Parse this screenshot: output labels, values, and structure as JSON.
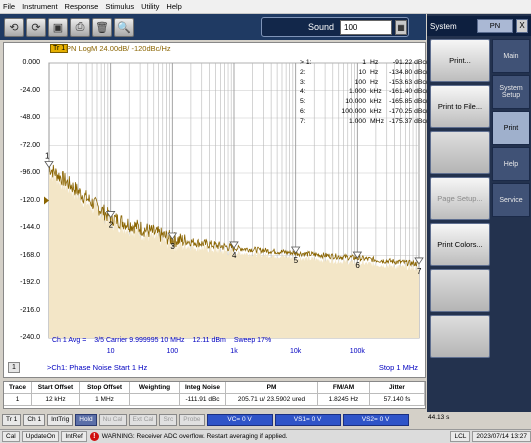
{
  "menu": [
    "File",
    "Instrument",
    "Response",
    "Stimulus",
    "Utility",
    "Help"
  ],
  "toolbar": {
    "icons": [
      "undo-icon",
      "redo-icon",
      "save-icon",
      "print-icon",
      "trash-icon",
      "zoom-icon"
    ],
    "glyphs": [
      "⟲",
      "⟳",
      "▣",
      "⎙",
      "🗑",
      "🔍"
    ],
    "sound_label": "Sound",
    "sound_value": "100"
  },
  "system": {
    "title": "System",
    "dropdown": "PN",
    "close": "X",
    "softkeys": [
      "Print...",
      "Print to File...",
      "",
      "Page Setup...",
      "Print Colors...",
      "",
      ""
    ],
    "tabs": [
      "Main",
      "System Setup",
      "Print",
      "Help",
      "Service"
    ]
  },
  "graph": {
    "trace_tag": "Tr 1",
    "trace_title": "PN LogM 24.00dB/ -120dBc/Hz",
    "y_ticks": [
      "0.000",
      "-24.00",
      "-48.00",
      "-72.00",
      "-96.00",
      "-120.0",
      "-144.0",
      "-168.0",
      "-192.0",
      "-216.0",
      "-240.0"
    ],
    "x_ticks": [
      "10",
      "100",
      "1k",
      "10k",
      "100k"
    ],
    "markers": [
      {
        "n": "> 1:",
        "v": "1",
        "u": "Hz",
        "r": "-91.22 dBc/Hz"
      },
      {
        "n": "2:",
        "v": "10",
        "u": "Hz",
        "r": "-134.80 dBc/Hz"
      },
      {
        "n": "3:",
        "v": "100",
        "u": "Hz",
        "r": "-153.63 dBc/Hz"
      },
      {
        "n": "4:",
        "v": "1.000",
        "u": "kHz",
        "r": "-161.40 dBc/Hz"
      },
      {
        "n": "5:",
        "v": "10.000",
        "u": "kHz",
        "r": "-165.85 dBc/Hz"
      },
      {
        "n": "6:",
        "v": "100.000",
        "u": "kHz",
        "r": "-170.25 dBc/Hz"
      },
      {
        "n": "7:",
        "v": "1.000",
        "u": "MHz",
        "r": "-175.37 dBc/Hz"
      }
    ],
    "status": [
      "Ch 1 Avg =",
      "3/5 Carrier 9.999995 10 MHz",
      "12.11 dBm",
      "Sweep 17%"
    ],
    "start": ">Ch1: Phase Noise Start 1 Hz",
    "stop": "Stop 1 MHz",
    "channel": "1"
  },
  "chart_data": {
    "type": "line",
    "title": "PN LogM 24.00dB/ -120dBc/Hz",
    "xscale": "log",
    "xlim": [
      1,
      1000000
    ],
    "ylim": [
      -240,
      0
    ],
    "x": [
      1,
      10,
      100,
      1000,
      10000,
      100000,
      1000000
    ],
    "series": [
      {
        "values": [
          -91.22,
          -134.8,
          -153.63,
          -161.4,
          -165.85,
          -170.25,
          -175.37
        ]
      }
    ]
  },
  "table": {
    "headers": [
      "Trace",
      "Start Offset",
      "Stop Offset",
      "Weighting",
      "Integ Noise",
      "PM",
      "FM/AM",
      "Jitter"
    ],
    "row": [
      "1",
      "12 kHz",
      "1 MHz",
      "",
      "-111.91 dBc",
      "205.71 u/ 23.5902 ured",
      "1.8245 Hz",
      "57.140 fs"
    ]
  },
  "bottom": {
    "buttons": [
      "Tr 1",
      "Ch 1",
      "IntTrig",
      "Hold",
      "Nu Cal",
      "Ext Cal",
      "Src",
      "Probe"
    ],
    "vc": "VC= 0 V",
    "vs1": "VS1= 0 V",
    "vs2": "VS2= 0 V",
    "time": "44.13 s"
  },
  "statusbar": {
    "c1": "Cal",
    "c2": "UpdateOn",
    "c3": "IntRef",
    "warning": "WARNING: Receiver ADC overflow. Restart averaging if applied.",
    "c4": "LCL",
    "datetime": "2023/07/14 13:27"
  },
  "colors": {
    "trace": "#8a6400",
    "fill": "#f3e6c7",
    "accent": "#2f54c8"
  }
}
